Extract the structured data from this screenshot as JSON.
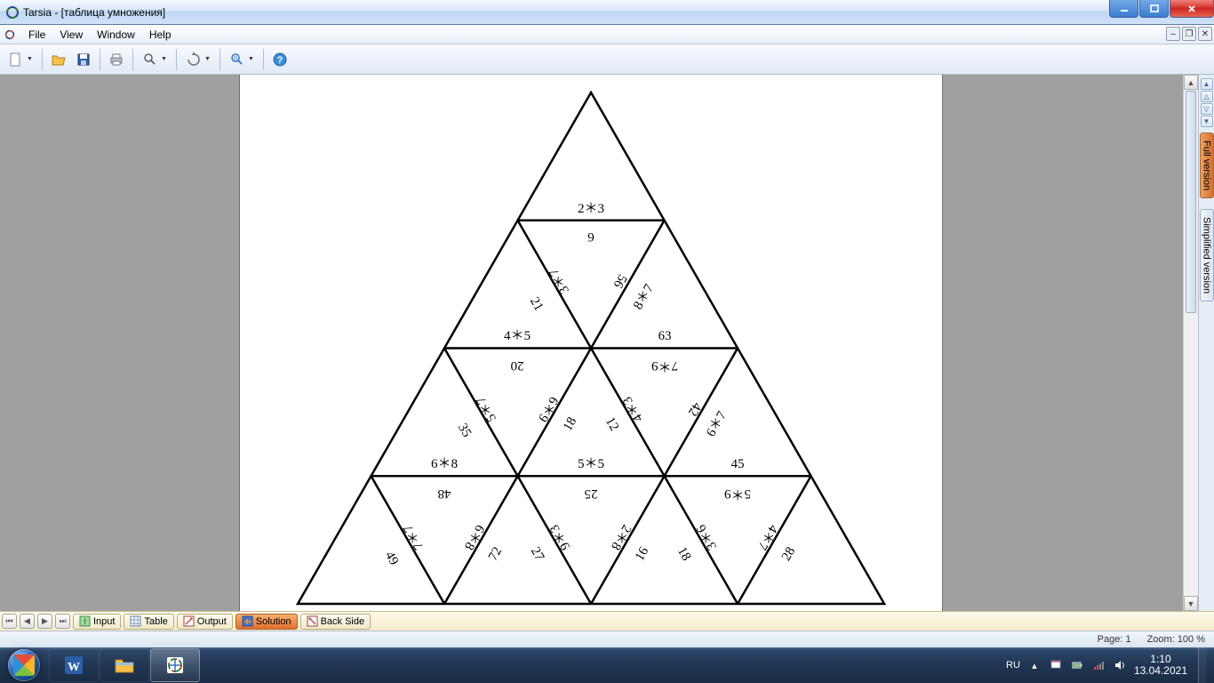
{
  "titlebar": {
    "title": "Tarsia - [таблица умножения]"
  },
  "menu": {
    "file": "File",
    "view": "View",
    "window": "Window",
    "help": "Help"
  },
  "tabs": {
    "input": "Input",
    "table": "Table",
    "output": "Output",
    "solution": "Solution",
    "backside": "Back Side"
  },
  "sidetabs": {
    "full": "Full version",
    "simplified": "Simplified version"
  },
  "status": {
    "page": "Page: 1",
    "zoom": "Zoom: 100 %"
  },
  "tray": {
    "lang": "RU",
    "time": "1:10",
    "date": "13.04.2021"
  },
  "puzzle": {
    "r1": {
      "u1_b": "2＊3"
    },
    "r2": {
      "u1_b": "4＊5",
      "u1_r": "21",
      "d1_t": "6",
      "d1_l": "3＊7",
      "d1_r": "56",
      "u2_b": "63",
      "u2_l": "8＊7"
    },
    "r3": {
      "u1_b": "6＊8",
      "u1_r": "35",
      "d1_t": "20",
      "d1_l": "5＊7",
      "d1_r": "6＊9",
      "u2_b": "5＊5",
      "u2_l": "18",
      "u2_r": "12",
      "d2_t": "7＊9",
      "d2_l": "4＊3",
      "d2_r": "42",
      "u3_b": "45",
      "u3_l": "6＊7"
    },
    "r4": {
      "u1_r": "49",
      "d1_t": "48",
      "d1_l": "7＊7",
      "d1_r": "6＊8",
      "u2_l": "72",
      "u2_r": "27",
      "d2_t": "25",
      "d2_l": "9＊3",
      "d2_r": "2＊8",
      "u3_l": "16",
      "u3_r": "18",
      "d3_t": "5＊9",
      "d3_l": "3＊6",
      "d3_r": "4＊7",
      "u4_l": "28"
    }
  }
}
